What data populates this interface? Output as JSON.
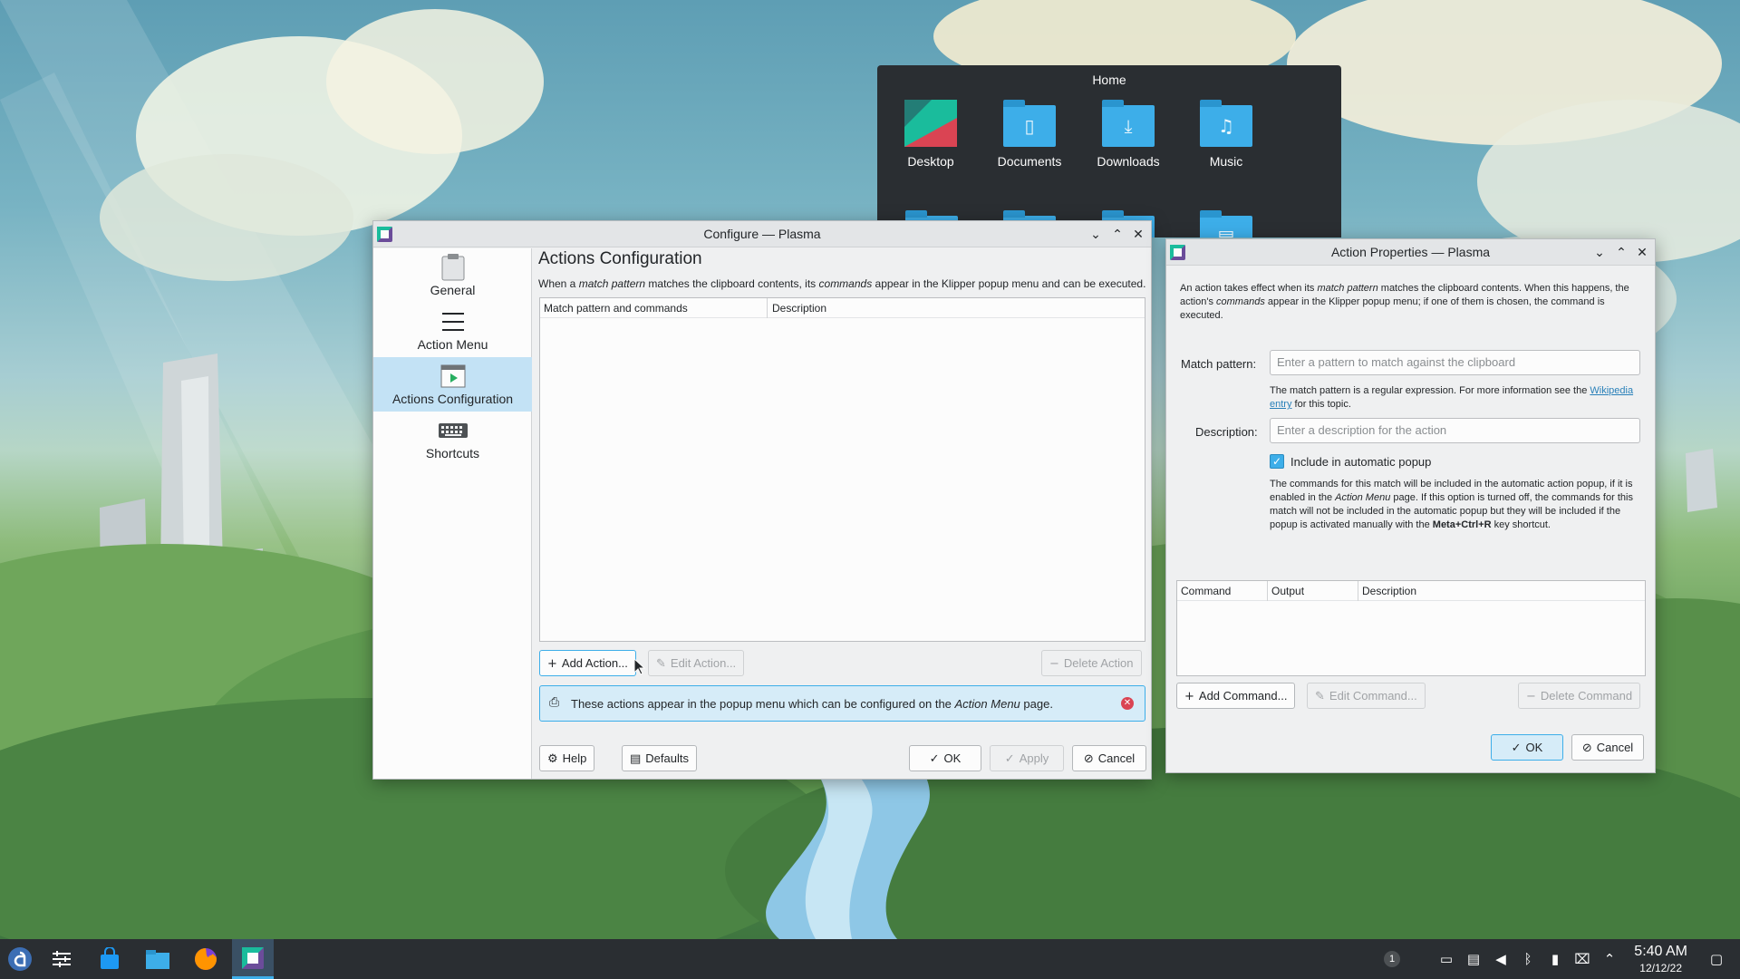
{
  "folderview": {
    "title": "Home",
    "items": [
      {
        "label": "Desktop",
        "icon": "desktop-folder-icon"
      },
      {
        "label": "Documents",
        "icon": "documents-folder-icon"
      },
      {
        "label": "Downloads",
        "icon": "downloads-folder-icon"
      },
      {
        "label": "Music",
        "icon": "music-folder-icon"
      }
    ]
  },
  "configure": {
    "title": "Configure — Plasma",
    "sidebar": [
      {
        "label": "General",
        "icon": "clipboard-icon"
      },
      {
        "label": "Action Menu",
        "icon": "menu-icon"
      },
      {
        "label": "Actions Configuration",
        "icon": "actions-icon"
      },
      {
        "label": "Shortcuts",
        "icon": "keyboard-icon"
      }
    ],
    "heading": "Actions Configuration",
    "desc": {
      "p1": "When a ",
      "em1": "match pattern",
      "p2": " matches the clipboard contents, its ",
      "em2": "commands",
      "p3": " appear in the Klipper popup menu and can be executed."
    },
    "columns": [
      "Match pattern and commands",
      "Description"
    ],
    "add_action": "Add Action...",
    "edit_action": "Edit Action...",
    "delete_action": "Delete Action",
    "info": {
      "p1": "These actions appear in the popup menu which can be configured on the ",
      "em": "Action Menu",
      "p2": " page."
    },
    "help": "Help",
    "defaults": "Defaults",
    "ok": "OK",
    "apply": "Apply",
    "cancel": "Cancel"
  },
  "props": {
    "title": "Action Properties — Plasma",
    "intro": {
      "p1": "An action takes effect when its ",
      "em1": "match pattern",
      "p2": " matches the clipboard contents. When this happens, the action's ",
      "em2": "commands",
      "p3": " appear in the Klipper popup menu; if one of them is chosen, the command is executed."
    },
    "match_label": "Match pattern:",
    "match_placeholder": "Enter a pattern to match against the clipboard",
    "match_help": {
      "p1": "The match pattern is a regular expression. For more information see the ",
      "link": "Wikipedia entry",
      "p2": " for this topic."
    },
    "desc_label": "Description:",
    "desc_placeholder": "Enter a description for the action",
    "checkbox_label": "Include in automatic popup",
    "checkbox_help": {
      "p1": "The commands for this match will be included in the automatic action popup, if it is enabled in the ",
      "em": "Action Menu",
      "p2": " page. If this option is turned off, the commands for this match will not be included in the automatic popup but they will be included if the popup is activated manually with the ",
      "strong": "Meta+Ctrl+R",
      "p3": " key shortcut."
    },
    "columns": [
      "Command",
      "Output",
      "Description"
    ],
    "add_command": "Add Command...",
    "edit_command": "Edit Command...",
    "delete_command": "Delete Command",
    "ok": "OK",
    "cancel": "Cancel"
  },
  "taskbar": {
    "notification_count": "1",
    "time": "5:40 AM",
    "date": "12/12/22"
  },
  "colors": {
    "accent": "#3daee9",
    "panel": "#2a2e32",
    "window": "#eff0f1",
    "info_bg": "#d6ecf8"
  }
}
